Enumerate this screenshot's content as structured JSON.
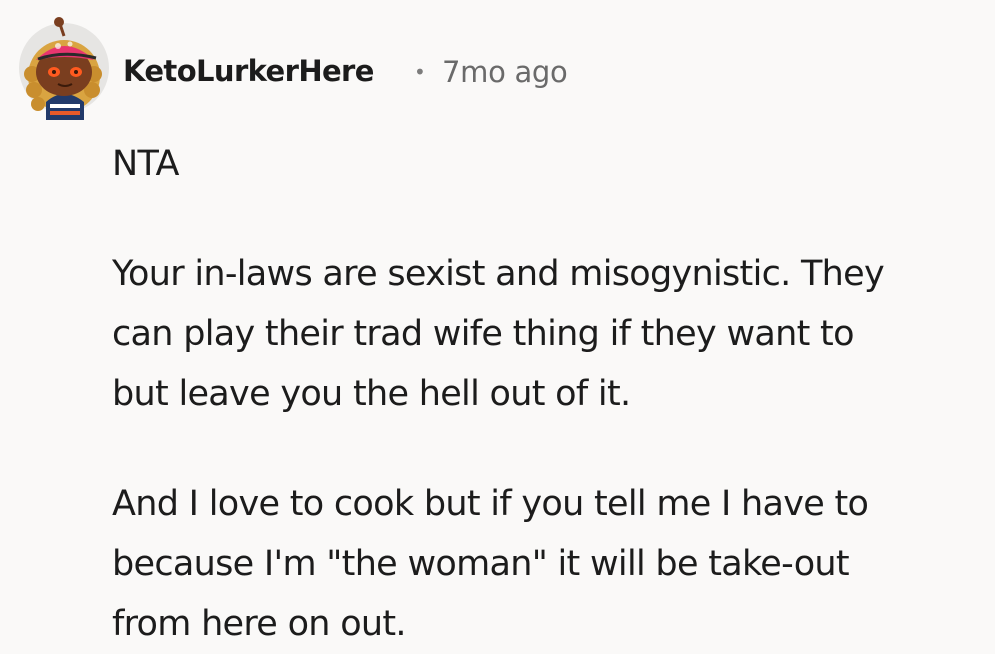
{
  "comment": {
    "author": "KetoLurkerHere",
    "separator": "•",
    "timestamp": "7mo ago",
    "avatar_icon": "snoo-avatar-icon",
    "paragraphs": [
      "NTA",
      "Your in-laws are sexist and misogynistic. They\ncan play their trad wife thing if they want to\nbut leave you the hell out of it.",
      "And I love to cook but if you tell me I have to\nbecause I'm \"the woman\" it will be take-out\nfrom here on out."
    ]
  },
  "colors": {
    "background": "#faf9f8",
    "text": "#1c1c1c",
    "meta": "#6a6a6a",
    "avatar_bg": "#e6e5e3",
    "hat": "#e8366f",
    "skin": "#7a3e1f",
    "hair": "#d9a441"
  }
}
